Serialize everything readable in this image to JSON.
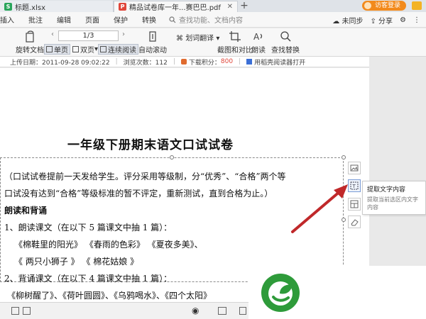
{
  "tabs": [
    {
      "label": "标题.xlsx",
      "icon": "spreadsheet-icon"
    },
    {
      "label": "精品试卷库一年...赛巴巴.pdf",
      "icon": "pdf-icon"
    }
  ],
  "login_label": "访客登录",
  "menu": {
    "items": [
      "插入",
      "批注",
      "编辑",
      "页面",
      "保护",
      "转换"
    ],
    "search_placeholder": "查找功能、文档内容",
    "right": {
      "sync": "未同步",
      "share": "分享"
    }
  },
  "toolbar": {
    "rotate": "旋转文档",
    "page_value": "1/3",
    "single_page": "单页",
    "double_page": "双页",
    "continuous": "连续阅读",
    "auto_scroll": "自动滚动",
    "translate": "划词翻译",
    "screenshot": "截图和对比",
    "read_aloud": "朗读",
    "find_replace": "查找替换"
  },
  "info": {
    "upload_date": "上传日期：2011-09-28 09:02:22",
    "views": "浏览次数：112",
    "points_label": "下载积分：",
    "points_value": "800",
    "open_with": "用稻壳阅读器打开"
  },
  "document": {
    "title": "一年级下册期末语文口试试卷",
    "lines": [
      "（口试试卷提前一天发给学生。评分采用等级制，分“优秀”、“合格”两个等",
      "口试没有达到“合格”等级标准的暂不评定，重新测试，直到合格为止。）",
      "朗读和背诵",
      "1、朗读课文（在以下 5 篇课文中抽 1 篇）：",
      "《棉鞋里的阳光》        《春雨的色彩》      《夏夜多美》、",
      "《 两只小狮子 》         《 棉花姑娘 》",
      "2、背诵课文（在以下 4 篇课文中抽 1 篇）：",
      "《柳树醒了》、《荷叶圆圆》、《乌鸦喝水》、《四个太阳》"
    ]
  },
  "tooltip": {
    "title": "提取文字内容",
    "description": "提取当前选区内文字内容"
  },
  "colors": {
    "accent_orange": "#f28a1c",
    "arrow_red": "#c0282a",
    "logo_green": "#2e9b3a"
  }
}
